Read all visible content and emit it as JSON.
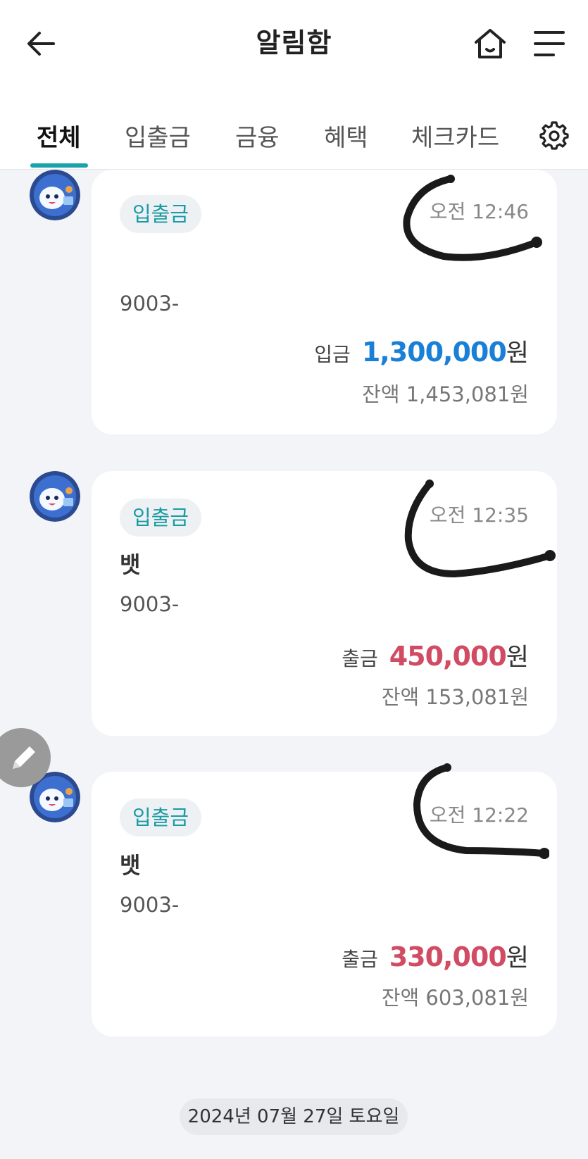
{
  "header": {
    "title": "알림함",
    "tabs": [
      {
        "label": "전체",
        "active": true
      },
      {
        "label": "입출금"
      },
      {
        "label": "금융"
      },
      {
        "label": "혜택"
      },
      {
        "label": "체크카드"
      }
    ]
  },
  "colors": {
    "accent": "#1aa3ab",
    "deposit": "#1a7fd6",
    "withdrawal": "#d14b63"
  },
  "notifications": [
    {
      "chip": "입출금",
      "time": "오전 12:46",
      "name": "",
      "account": "9003-",
      "amount_label": "입금",
      "amount": "1,300,000",
      "unit": "원",
      "balance": "잔액 1,453,081원"
    },
    {
      "chip": "입출금",
      "time": "오전 12:35",
      "name": "뱃",
      "account": "9003-",
      "amount_label": "출금",
      "amount": "450,000",
      "unit": "원",
      "balance": "잔액 153,081원"
    },
    {
      "chip": "입출금",
      "time": "오전 12:22",
      "name": "뱃",
      "account": "9003-",
      "amount_label": "출금",
      "amount": "330,000",
      "unit": "원",
      "balance": "잔액 603,081원"
    }
  ],
  "date_divider": "2024년 07월 27일 토요일",
  "icons": [
    "back-arrow-icon",
    "home-icon",
    "menu-icon",
    "settings-gear-icon",
    "pencil-icon"
  ]
}
